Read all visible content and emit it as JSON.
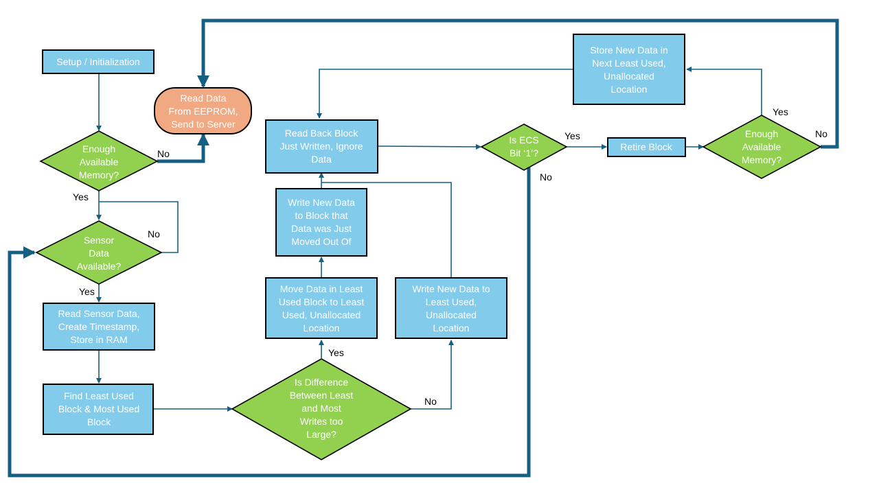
{
  "diagram": {
    "nodes": {
      "setup": {
        "text": [
          "Setup / Initialization"
        ],
        "shape": "process"
      },
      "read_eeprom": {
        "text": [
          "Read Data",
          "From EEPROM,",
          "Send to Server"
        ],
        "shape": "terminator"
      },
      "enough_mem_1": {
        "text": [
          "Enough",
          "Available",
          "Memory?"
        ],
        "shape": "decision"
      },
      "sensor_avail": {
        "text": [
          "Sensor",
          "Data",
          "Available?"
        ],
        "shape": "decision"
      },
      "read_sensor": {
        "text": [
          "Read Sensor Data,",
          "Create Timestamp,",
          "Store in RAM"
        ],
        "shape": "process"
      },
      "find_blocks": {
        "text": [
          "Find Least Used",
          "Block & Most Used",
          "Block"
        ],
        "shape": "process"
      },
      "is_difference": {
        "text": [
          "Is Difference",
          "Between Least",
          "and Most",
          "Writes too",
          "Large?"
        ],
        "shape": "decision"
      },
      "move_data": {
        "text": [
          "Move Data in Least",
          "Used Block to Least",
          "Used, Unallocated",
          "Location"
        ],
        "shape": "process"
      },
      "write_moved": {
        "text": [
          "Write New Data",
          "to Block that",
          "Data was Just",
          "Moved Out Of"
        ],
        "shape": "process"
      },
      "write_least": {
        "text": [
          "Write New Data to",
          "Least Used,",
          "Unallocated",
          "Location"
        ],
        "shape": "process"
      },
      "read_back": {
        "text": [
          "Read Back Block",
          "Just Written, Ignore",
          "Data"
        ],
        "shape": "process"
      },
      "is_ecs": {
        "text": [
          "Is ECS",
          "Bit ‘1’?"
        ],
        "shape": "decision"
      },
      "retire": {
        "text": [
          "Retire Block"
        ],
        "shape": "process"
      },
      "enough_mem_2": {
        "text": [
          "Enough",
          "Available",
          "Memory?"
        ],
        "shape": "decision"
      },
      "store_next": {
        "text": [
          "Store New Data in",
          "Next Least Used,",
          "Unallocated",
          "Location"
        ],
        "shape": "process"
      }
    },
    "edge_labels": {
      "mem1_no": "No",
      "mem1_yes": "Yes",
      "sensor_no": "No",
      "sensor_yes": "Yes",
      "diff_yes": "Yes",
      "diff_no": "No",
      "ecs_yes": "Yes",
      "ecs_no": "No",
      "mem2_yes": "Yes",
      "mem2_no": "No"
    },
    "colors": {
      "process_fill": "#83cbeb",
      "terminator_fill": "#f1a983",
      "decision_fill": "#92d050",
      "connector": "#156082"
    }
  }
}
